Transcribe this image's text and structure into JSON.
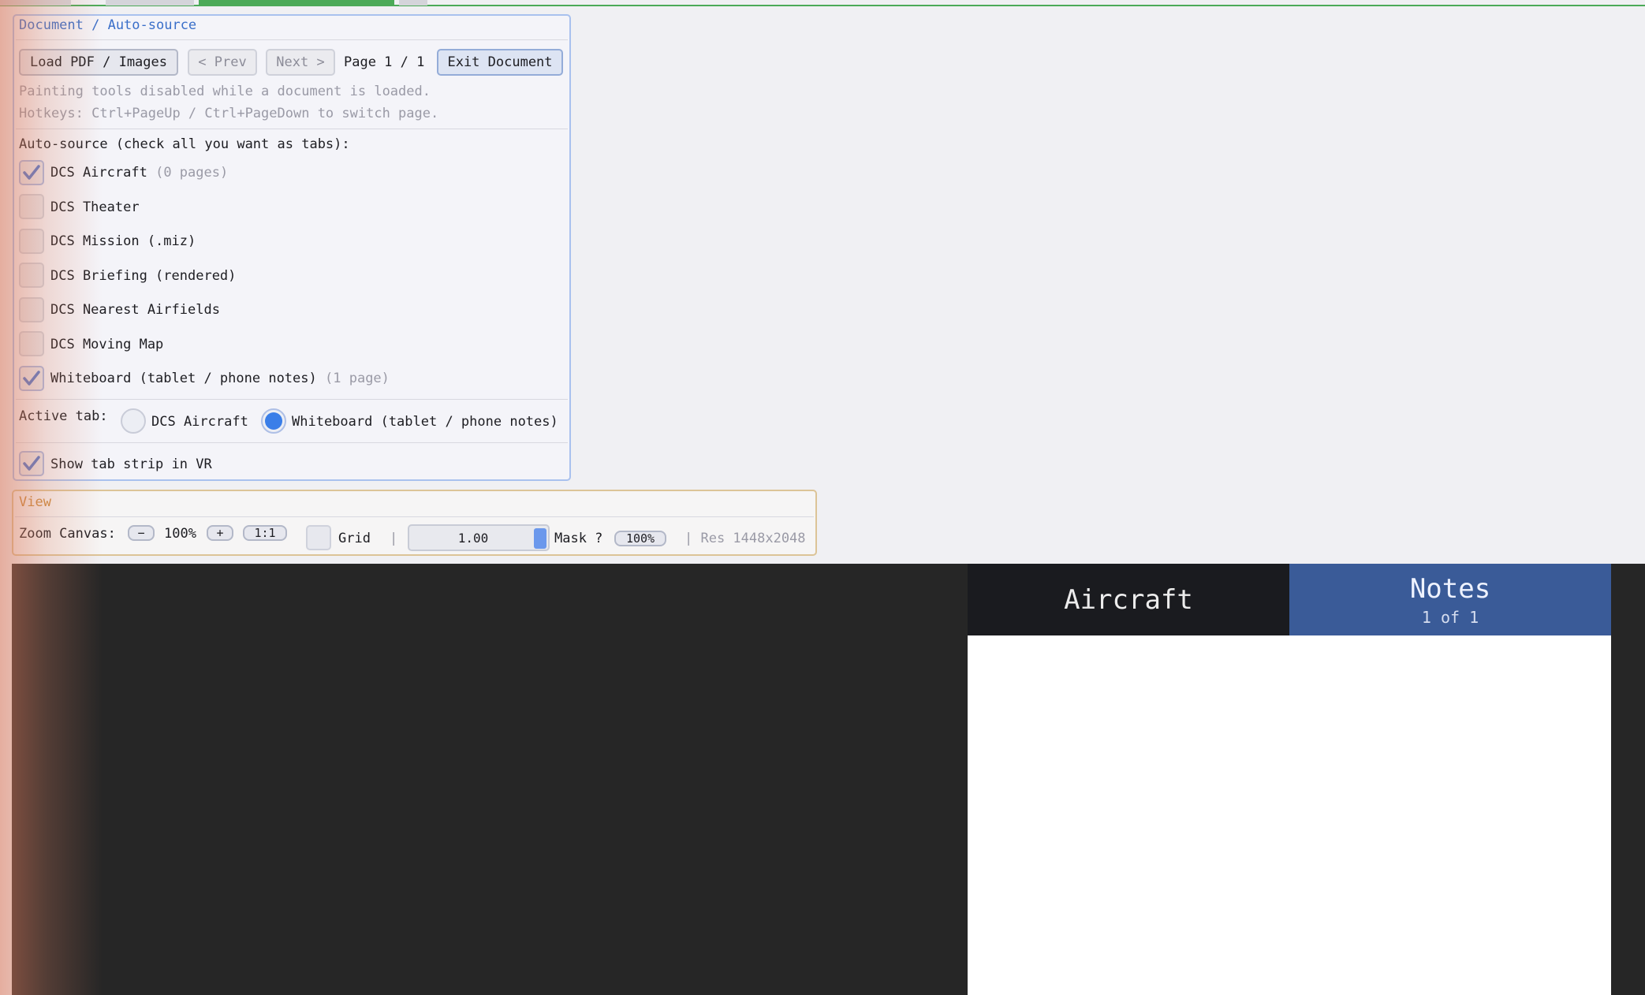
{
  "document_panel": {
    "title": "Document / Auto-source",
    "load_button": "Load PDF / Images",
    "prev_button": "< Prev",
    "next_button": "Next >",
    "page_indicator": "Page 1 / 1",
    "exit_button": "Exit Document",
    "hint_painting": "Painting tools disabled while a document is loaded.",
    "hint_hotkeys": "Hotkeys: Ctrl+PageUp / Ctrl+PageDown to switch page.",
    "autosource_heading": "Auto-source (check all you want as tabs):",
    "sources": [
      {
        "label": "DCS Aircraft",
        "count": "(0 pages)",
        "checked": true
      },
      {
        "label": "DCS Theater",
        "count": "",
        "checked": false
      },
      {
        "label": "DCS Mission (.miz)",
        "count": "",
        "checked": false
      },
      {
        "label": "DCS Briefing (rendered)",
        "count": "",
        "checked": false
      },
      {
        "label": "DCS Nearest Airfields",
        "count": "",
        "checked": false
      },
      {
        "label": "DCS Moving Map",
        "count": "",
        "checked": false
      },
      {
        "label": "Whiteboard (tablet / phone notes)",
        "count": "(1 page)",
        "checked": true
      }
    ],
    "active_tab_label": "Active tab:",
    "active_tab_options": [
      {
        "label": "DCS Aircraft",
        "selected": false
      },
      {
        "label": "Whiteboard (tablet / phone notes)",
        "selected": true
      }
    ],
    "show_tab_strip_label": "Show tab strip in VR",
    "show_tab_strip_checked": true
  },
  "view_panel": {
    "title": "View",
    "zoom_label": "Zoom Canvas:",
    "zoom_minus": "−",
    "zoom_value": "100%",
    "zoom_plus": "+",
    "zoom_reset": "1:1",
    "grid_label": "Grid",
    "pipe_1": "|",
    "slider_value": "1.00",
    "mask_label": "Mask ?",
    "mask_value": "100%",
    "res_text": "| Res 1448x2048"
  },
  "vr_tabs": {
    "tab_a_label": "Aircraft",
    "tab_b_label": "Notes",
    "tab_b_sub": "1 of 1"
  },
  "colors": {
    "accent_blue": "#3a7ee8",
    "vr_active_tab": "#3a5b98",
    "top_tab_green": "#4caa58"
  },
  "icons": {
    "check": "check-mark-icon"
  }
}
